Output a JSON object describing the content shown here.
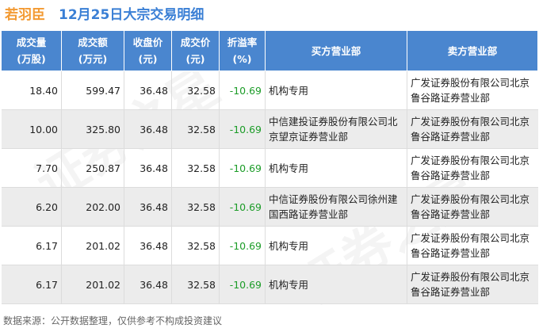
{
  "header": {
    "brand": "若羽臣",
    "title": "12月25日大宗交易明细"
  },
  "table": {
    "columns": [
      {
        "line1": "成交量",
        "line2": "(万股)"
      },
      {
        "line1": "成交额",
        "line2": "(万元)"
      },
      {
        "line1": "收盘价",
        "line2": "(元)"
      },
      {
        "line1": "成交价",
        "line2": "(元)"
      },
      {
        "line1": "折溢率",
        "line2": "(%)"
      },
      {
        "line1": "买方营业部",
        "line2": ""
      },
      {
        "line1": "卖方营业部",
        "line2": ""
      }
    ],
    "rows": [
      {
        "volume": "18.40",
        "amount": "599.47",
        "close": "36.48",
        "price": "32.58",
        "premium": "-10.69",
        "buyer": "机构专用",
        "seller": "广发证券股份有限公司北京鲁谷路证券营业部"
      },
      {
        "volume": "10.00",
        "amount": "325.80",
        "close": "36.48",
        "price": "32.58",
        "premium": "-10.69",
        "buyer": "中信建投证券股份有限公司北京望京证券营业部",
        "seller": "广发证券股份有限公司北京鲁谷路证券营业部"
      },
      {
        "volume": "7.70",
        "amount": "250.87",
        "close": "36.48",
        "price": "32.58",
        "premium": "-10.69",
        "buyer": "机构专用",
        "seller": "广发证券股份有限公司北京鲁谷路证券营业部"
      },
      {
        "volume": "6.20",
        "amount": "202.00",
        "close": "36.48",
        "price": "32.58",
        "premium": "-10.69",
        "buyer": "中信证券股份有限公司徐州建国西路证券营业部",
        "seller": "广发证券股份有限公司北京鲁谷路证券营业部"
      },
      {
        "volume": "6.17",
        "amount": "201.02",
        "close": "36.48",
        "price": "32.58",
        "premium": "-10.69",
        "buyer": "机构专用",
        "seller": "广发证券股份有限公司北京鲁谷路证券营业部"
      },
      {
        "volume": "6.17",
        "amount": "201.02",
        "close": "36.48",
        "price": "32.58",
        "premium": "-10.69",
        "buyer": "机构专用",
        "seller": "广发证券股份有限公司北京鲁谷路证券营业部"
      }
    ]
  },
  "footer": {
    "source": "数据来源：公开数据整理，仅供参考不构成投资建议"
  },
  "watermark": "证券之星",
  "colors": {
    "brand": "#f39a32",
    "title": "#3a7fd5",
    "header_bg": "#4a86cf",
    "negative": "#1c9c28"
  }
}
